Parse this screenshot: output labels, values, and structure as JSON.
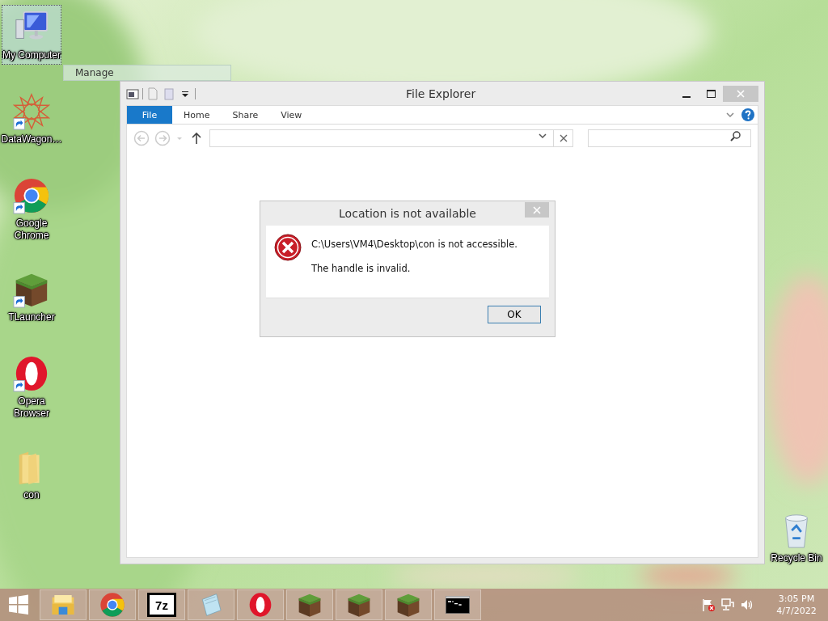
{
  "desktop_icons": [
    {
      "kind": "computer",
      "label": "My Computer",
      "selected": true,
      "shortcut": false
    },
    {
      "kind": "star",
      "label": "DataWagon…",
      "selected": false,
      "shortcut": true
    },
    {
      "kind": "chrome",
      "label": "Google Chrome",
      "selected": false,
      "shortcut": true
    },
    {
      "kind": "block",
      "label": "TLauncher",
      "selected": false,
      "shortcut": true
    },
    {
      "kind": "opera",
      "label": "Opera Browser",
      "selected": false,
      "shortcut": true
    },
    {
      "kind": "folder",
      "label": "con",
      "selected": false,
      "shortcut": false
    }
  ],
  "recycle_bin": {
    "label": "Recycle Bin"
  },
  "context_tip": {
    "label": "Manage"
  },
  "explorer": {
    "title": "File Explorer",
    "tabs": [
      {
        "kind": "file",
        "label": "File"
      },
      {
        "kind": "tab",
        "label": "Home"
      },
      {
        "kind": "tab",
        "label": "Share"
      },
      {
        "kind": "tab",
        "label": "View"
      }
    ]
  },
  "dialog": {
    "title": "Location is not available",
    "message": "C:\\Users\\VM4\\Desktop\\con is not accessible.",
    "detail": "The handle is invalid.",
    "button": "OK"
  },
  "taskbar": {
    "apps": [
      {
        "kind": "explorer"
      },
      {
        "kind": "chrome"
      },
      {
        "kind": "archive",
        "label": "7z"
      },
      {
        "kind": "notepad"
      },
      {
        "kind": "opera"
      },
      {
        "kind": "block"
      },
      {
        "kind": "block"
      },
      {
        "kind": "block"
      },
      {
        "kind": "console"
      }
    ],
    "time": "3:05 PM",
    "date": "4/7/2022"
  }
}
